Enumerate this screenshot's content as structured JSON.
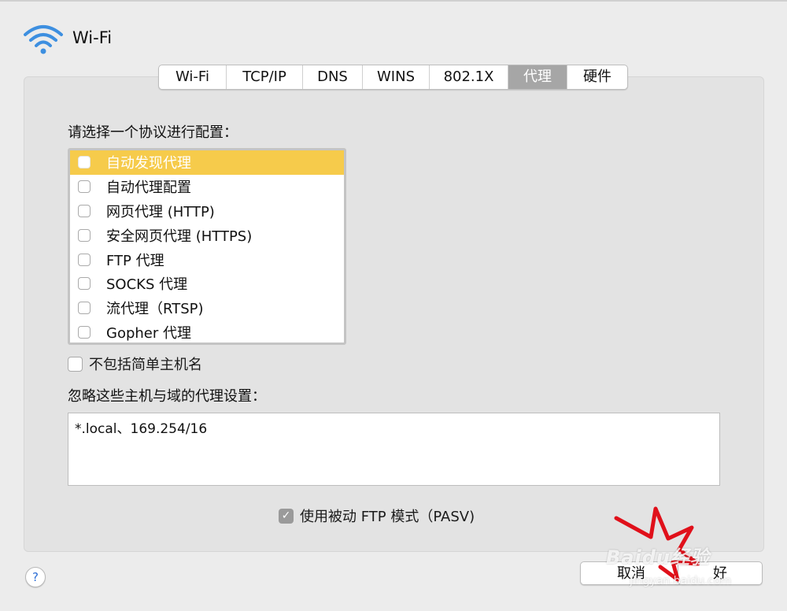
{
  "window": {
    "title": "Wi-Fi"
  },
  "tabs": [
    {
      "label": "Wi-Fi",
      "active": false
    },
    {
      "label": "TCP/IP",
      "active": false
    },
    {
      "label": "DNS",
      "active": false
    },
    {
      "label": "WINS",
      "active": false
    },
    {
      "label": "802.1X",
      "active": false
    },
    {
      "label": "代理",
      "active": true
    },
    {
      "label": "硬件",
      "active": false
    }
  ],
  "proxy": {
    "select_label": "请选择一个协议进行配置：",
    "protocols": [
      {
        "label": "自动发现代理",
        "checked": false,
        "selected": true
      },
      {
        "label": "自动代理配置",
        "checked": false,
        "selected": false
      },
      {
        "label": "网页代理 (HTTP)",
        "checked": false,
        "selected": false
      },
      {
        "label": "安全网页代理 (HTTPS)",
        "checked": false,
        "selected": false
      },
      {
        "label": "FTP 代理",
        "checked": false,
        "selected": false
      },
      {
        "label": "SOCKS 代理",
        "checked": false,
        "selected": false
      },
      {
        "label": "流代理（RTSP)",
        "checked": false,
        "selected": false
      },
      {
        "label": "Gopher 代理",
        "checked": false,
        "selected": false
      }
    ],
    "exclude_simple_hostnames": {
      "label": "不包括简单主机名",
      "checked": false
    },
    "bypass_label": "忽略这些主机与域的代理设置：",
    "bypass_value": "*.local、169.254/16",
    "passive_ftp": {
      "label": "使用被动 FTP 模式（PASV)",
      "checked": true
    }
  },
  "footer": {
    "help_label": "?",
    "cancel_label": "取消",
    "ok_label": "好"
  },
  "watermark": {
    "text": "Baidu经验",
    "sub": "jingyan.baidu.com"
  },
  "colors": {
    "selection": "#f6cb4b",
    "active_tab": "#a6a6a6",
    "help_icon": "#2d6fd6",
    "annotation": "#e0101a",
    "wifi_icon": "#3d8fe0"
  }
}
